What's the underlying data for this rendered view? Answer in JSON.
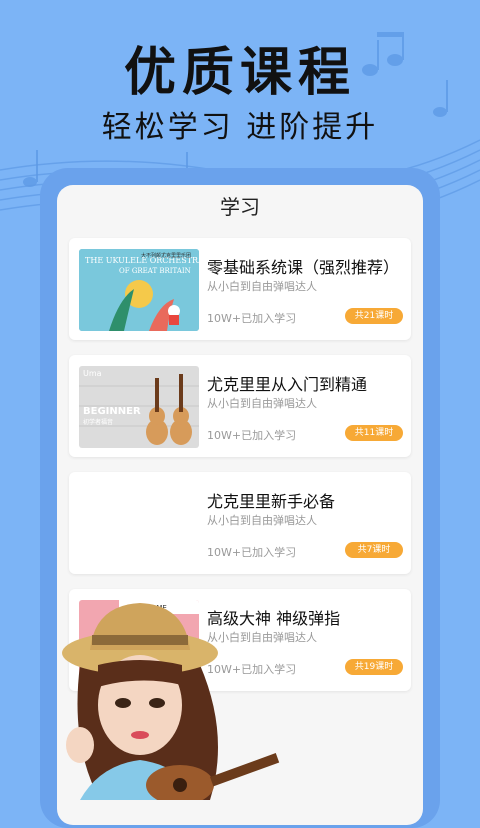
{
  "banner": {
    "headline": "优质课程",
    "subline": "轻松学习 进阶提升"
  },
  "screen": {
    "title": "学习",
    "courses": [
      {
        "title": "零基础系统课（强烈推荐）",
        "subtitle": "从小白到自由弹唱达人",
        "count": "10W+已加入学习",
        "lessons": "共21课时",
        "thumb_text": [
          "THE UKULELE ORCHESTRA",
          "OF GREAT BRITAIN",
          "大不列颠尤克里里乐团"
        ]
      },
      {
        "title": "尤克里里从入门到精通",
        "subtitle": "从小白到自由弹唱达人",
        "count": "10W+已加入学习",
        "lessons": "共11课时",
        "thumb_text": [
          "Uma",
          "BEGINNER",
          "初学者福音"
        ]
      },
      {
        "title": "尤克里里新手必备",
        "subtitle": "从小白到自由弹唱达人",
        "count": "10W+已加入学习",
        "lessons": "共7课时",
        "thumb_text": []
      },
      {
        "title": "高级大神 神级弹指",
        "subtitle": "从小白到自由弹唱达人",
        "count": "10W+已加入学习",
        "lessons": "共19课时",
        "thumb_text": [
          "MY HOME"
        ]
      }
    ]
  },
  "colors": {
    "background": "#7cb4f6",
    "tablet": "#6aa2ec",
    "badge": "#f7a936"
  }
}
